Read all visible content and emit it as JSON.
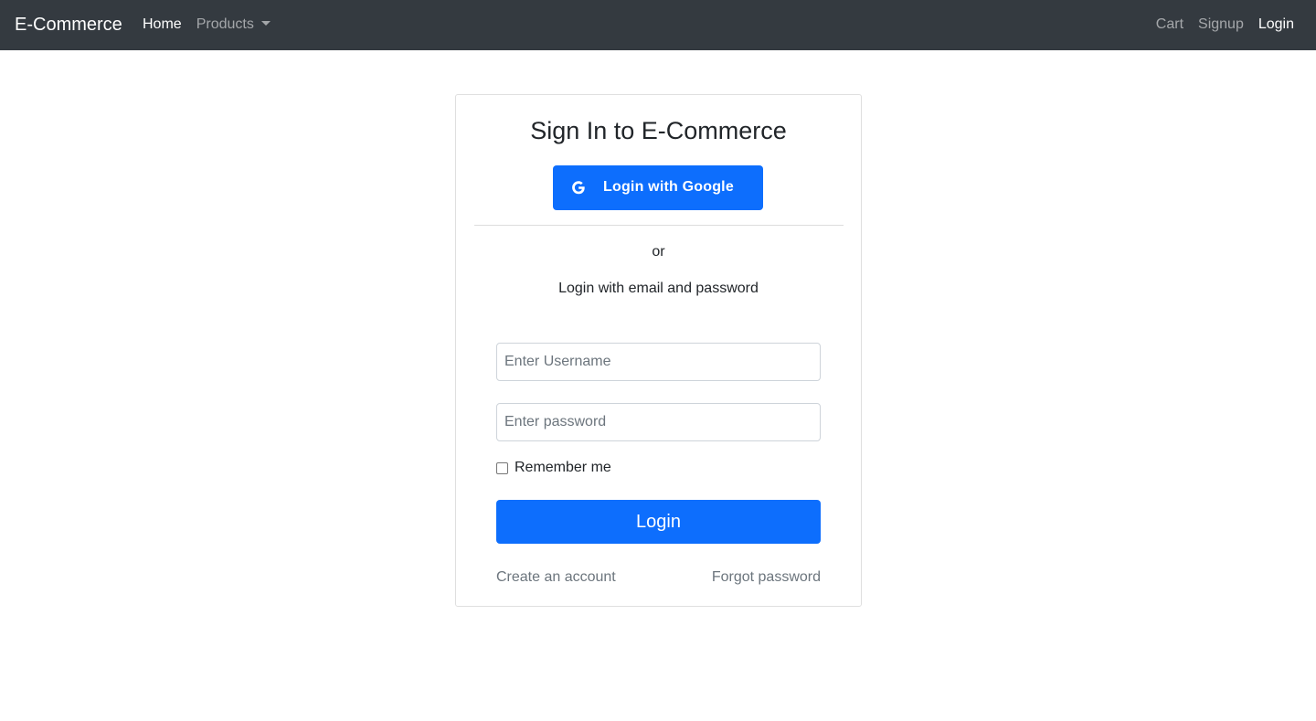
{
  "navbar": {
    "brand": "E-Commerce",
    "left_items": [
      {
        "label": "Home",
        "active": true
      },
      {
        "label": "Products",
        "dropdown": true
      }
    ],
    "right_items": [
      {
        "label": "Cart"
      },
      {
        "label": "Signup"
      },
      {
        "label": "Login",
        "active": true
      }
    ]
  },
  "login_card": {
    "title": "Sign In to E-Commerce",
    "google_button": {
      "label": "Login with Google",
      "icon": "google-g-icon"
    },
    "or_text": "or",
    "subtitle": "Login with email and password",
    "username": {
      "value": "",
      "placeholder": "Enter Username"
    },
    "password": {
      "value": "",
      "placeholder": "Enter password"
    },
    "remember_me": {
      "label": "Remember me",
      "checked": false
    },
    "login_button": "Login",
    "create_account_link": "Create an account",
    "forgot_password_link": "Forgot password"
  },
  "colors": {
    "navbar_bg": "#343a40",
    "primary": "#0d6efd",
    "muted_text": "#6c757d"
  }
}
